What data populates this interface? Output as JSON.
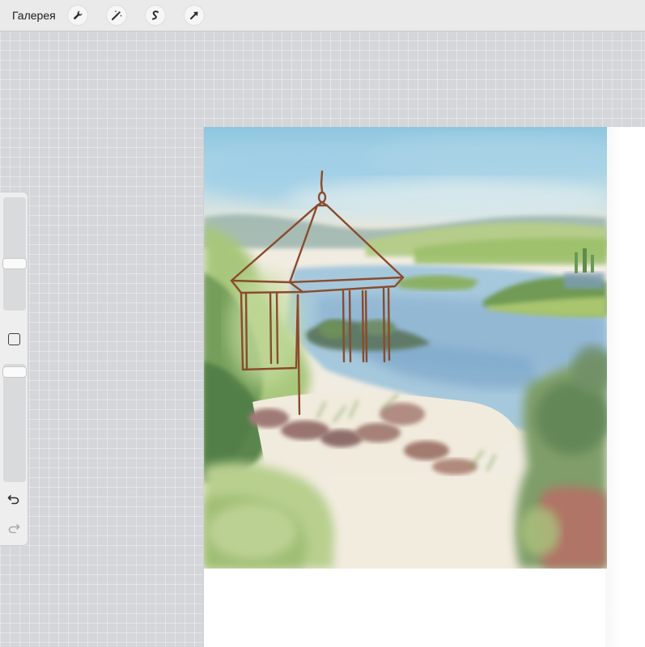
{
  "topbar": {
    "gallery_label": "Галерея",
    "tools": [
      {
        "name": "wrench-icon"
      },
      {
        "name": "magic-wand-icon"
      },
      {
        "name": "selection-s-icon"
      },
      {
        "name": "arrow-transform-icon"
      }
    ]
  },
  "sidebar": {
    "size_slider_level": 0.45,
    "opacity_slider_level": 0.95,
    "icons": [
      "square-icon",
      "undo-icon",
      "redo-icon"
    ]
  },
  "colors": {
    "toolbar_bg": "#eaeaeb",
    "workspace_bg": "#d4d6d9",
    "sketch_brown": "#8a4b2c"
  }
}
